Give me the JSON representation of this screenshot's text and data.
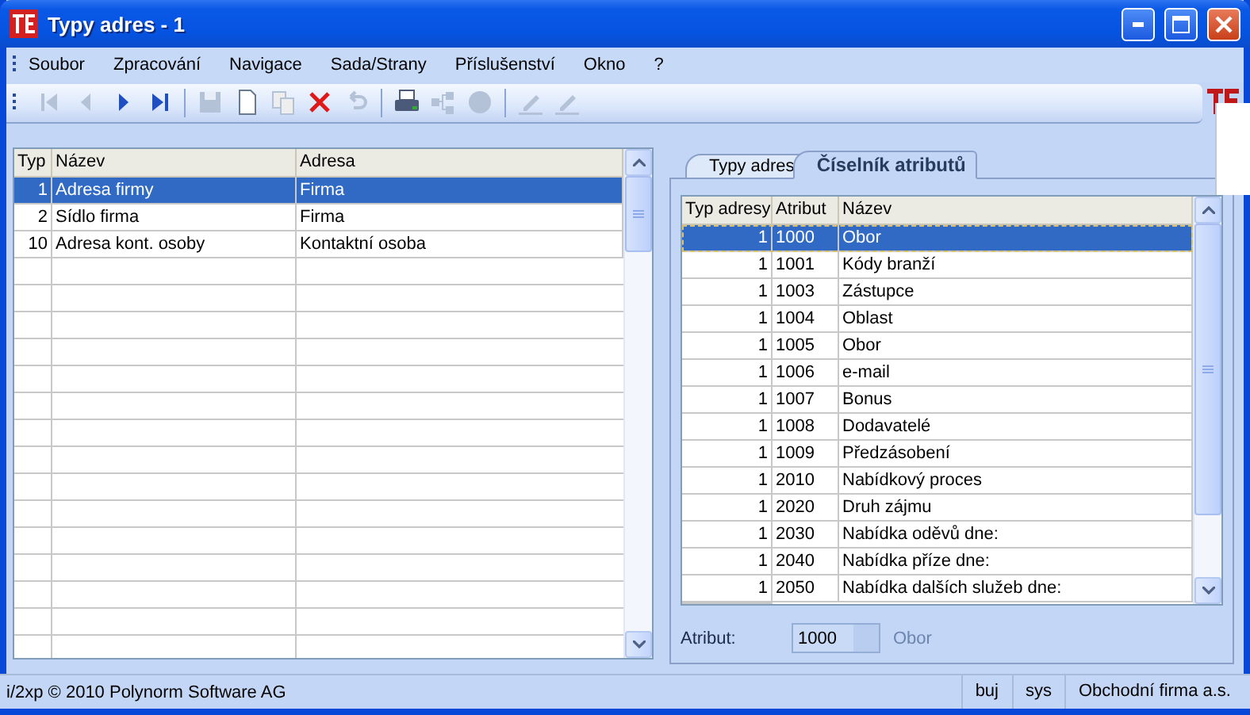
{
  "window": {
    "title": "Typy adres - 1"
  },
  "menu": [
    "Soubor",
    "Zpracování",
    "Navigace",
    "Sada/Strany",
    "Příslušenství",
    "Okno",
    "?"
  ],
  "toolbar": [
    [
      {
        "kind": "first",
        "disabled": true
      },
      {
        "kind": "prev",
        "disabled": true
      },
      {
        "kind": "next",
        "disabled": false
      },
      {
        "kind": "last",
        "disabled": false
      }
    ],
    [
      {
        "kind": "save",
        "disabled": true
      },
      {
        "kind": "new",
        "disabled": false
      },
      {
        "kind": "copy",
        "disabled": true
      },
      {
        "kind": "delete",
        "disabled": false
      },
      {
        "kind": "undo",
        "disabled": true
      }
    ],
    [
      {
        "kind": "print",
        "disabled": false
      },
      {
        "kind": "tree",
        "disabled": true
      },
      {
        "kind": "disc",
        "disabled": true
      }
    ],
    [
      {
        "kind": "pen",
        "disabled": true
      },
      {
        "kind": "pen",
        "disabled": true
      }
    ]
  ],
  "address_table": {
    "columns": [
      "Typ",
      "Název",
      "Adresa"
    ],
    "rows": [
      {
        "cells": [
          "1",
          "Adresa firmy",
          "Firma"
        ],
        "selected": true
      },
      {
        "cells": [
          "2",
          "Sídlo firma",
          "Firma"
        ],
        "selected": false
      },
      {
        "cells": [
          "10",
          "Adresa kont. osoby",
          "Kontaktní osoba"
        ],
        "selected": false
      }
    ]
  },
  "detail_panel": {
    "tabs": [
      {
        "label": "Typy adres",
        "selected": false
      },
      {
        "label": "Číselník atributů",
        "selected": true
      }
    ],
    "table": {
      "columns": [
        "Typ adresy",
        "Atribut",
        "Název"
      ],
      "rows": [
        {
          "cells": [
            "1",
            "1000",
            "Obor"
          ],
          "selected": true
        },
        {
          "cells": [
            "1",
            "1001",
            "Kódy branží"
          ],
          "selected": false
        },
        {
          "cells": [
            "1",
            "1003",
            "Zástupce"
          ],
          "selected": false
        },
        {
          "cells": [
            "1",
            "1004",
            "Oblast"
          ],
          "selected": false
        },
        {
          "cells": [
            "1",
            "1005",
            "Obor"
          ],
          "selected": false
        },
        {
          "cells": [
            "1",
            "1006",
            "e-mail"
          ],
          "selected": false
        },
        {
          "cells": [
            "1",
            "1007",
            "Bonus"
          ],
          "selected": false
        },
        {
          "cells": [
            "1",
            "1008",
            "Dodavatelé"
          ],
          "selected": false
        },
        {
          "cells": [
            "1",
            "1009",
            "Předzásobení"
          ],
          "selected": false
        },
        {
          "cells": [
            "1",
            "2010",
            "Nabídkový proces"
          ],
          "selected": false
        },
        {
          "cells": [
            "1",
            "2020",
            "Druh zájmu"
          ],
          "selected": false
        },
        {
          "cells": [
            "1",
            "2030",
            "Nabídka oděvů dne:"
          ],
          "selected": false
        },
        {
          "cells": [
            "1",
            "2040",
            "Nabídka příze dne:"
          ],
          "selected": false
        },
        {
          "cells": [
            "1",
            "2050",
            "Nabídka dalších služeb dne:"
          ],
          "selected": false
        }
      ]
    },
    "attribute_field": {
      "label": "Atribut:",
      "value": "1000",
      "description": "Obor"
    }
  },
  "status_bar": {
    "copyright": "i/2xp © 2010 Polynorm Software AG",
    "fields": [
      "buj",
      "sys",
      "Obchodní firma a.s."
    ]
  }
}
